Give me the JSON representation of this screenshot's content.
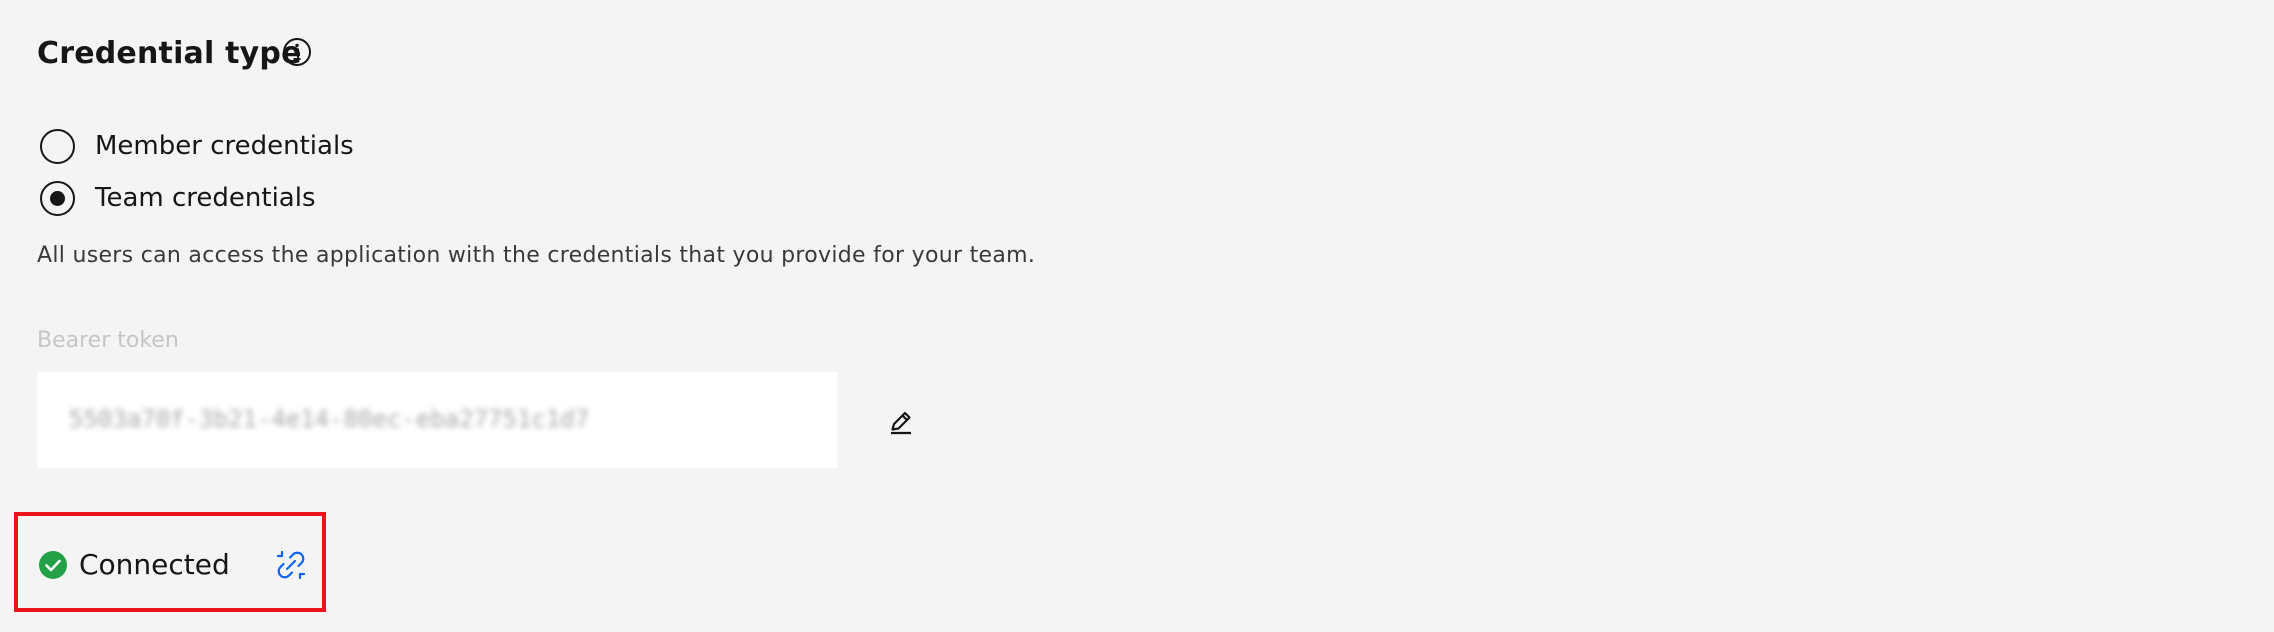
{
  "section": {
    "title": "Credential type",
    "info_icon": "info-icon"
  },
  "credential_options": [
    {
      "label": "Member credentials",
      "checked": false
    },
    {
      "label": "Team credentials",
      "checked": true
    }
  ],
  "helper_text": "All users can access the application with the credentials that you provide for your team.",
  "bearer_token": {
    "label": "Bearer token",
    "value": "5503a70f-3b21-4e14-80ec-eba27751c1d7",
    "edit_icon": "pencil-icon"
  },
  "connection": {
    "status": "Connected",
    "status_icon": "check-circle-icon",
    "status_color": "#24a148",
    "action_icon": "unlink-icon",
    "action_color": "#0f62fe"
  },
  "highlight_color": "#e8141a"
}
